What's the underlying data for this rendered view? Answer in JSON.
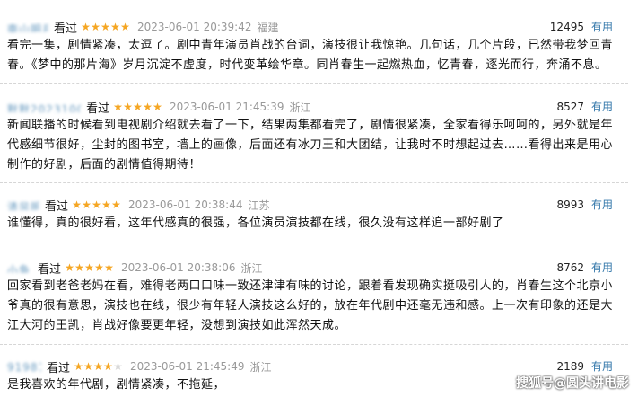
{
  "reviews": [
    {
      "user": "南山明月光",
      "status": "看过",
      "rating": 5,
      "time": "2023-06-01 20:39:42",
      "location": "福建",
      "votes": "12495",
      "useful_label": "有用",
      "text": "看完一集，剧情紧凑，太逗了。剧中青年演员肖战的台词，演技很让我惊艳。几句话，几个片段，已然带我梦回青春。《梦中的那片海》岁月沉淀不虚度，时代变革绘华章。同肖春生一起燃热血，忆青春，逐光而行，奔涌不息。"
    },
    {
      "user": "默默20231002",
      "status": "看过",
      "rating": 5,
      "time": "2023-06-01 21:45:39",
      "location": "浙江",
      "votes": "8527",
      "useful_label": "有用",
      "text": "新闻联播的时候看到电视剧介绍就去看了一下，结果两集都看完了，剧情很紧凑，全家看得乐呵呵的，另外就是年代感细节很好，尘封的图书室，墙上的画像，后面还有冰刀王和大团结，让我时不时想起过去……看得出来是用心制作的好剧，后面的剧情值得期待！"
    },
    {
      "user": "清风明月",
      "status": "看过",
      "rating": 5,
      "time": "2023-06-01 20:38:44",
      "location": "江苏",
      "votes": "8993",
      "useful_label": "有用",
      "text": "谁懂得，真的很好看，这年代感真的很强，各位演员演技都在线，很久没有这样追一部好剧了"
    },
    {
      "user": "小鱼儿",
      "status": "看过",
      "rating": 5,
      "time": "2023-06-01 20:38:06",
      "location": "浙江",
      "votes": "8762",
      "useful_label": "有用",
      "text": "回家看到老爸老妈在看，难得老两口口味一致还津津有味的讨论，跟着看发现确实挺吸引人的，肖春生这个北京小爷真的很有意思，演技也在线，很少有年轻人演技这么好的，放在年代剧中还毫无违和感。上一次有印象的还是大江大河的王凯，肖战好像要更年轻，没想到演技如此浑然天成。"
    },
    {
      "user": "919818",
      "status": "看过",
      "rating": 4,
      "time": "2023-06-01 21:45:49",
      "location": "浙江",
      "votes": "2189",
      "useful_label": "有用",
      "text": "是我喜欢的年代剧，剧情紧凑，不拖延，"
    }
  ],
  "watermark": "搜狐号@圆头讲电影"
}
